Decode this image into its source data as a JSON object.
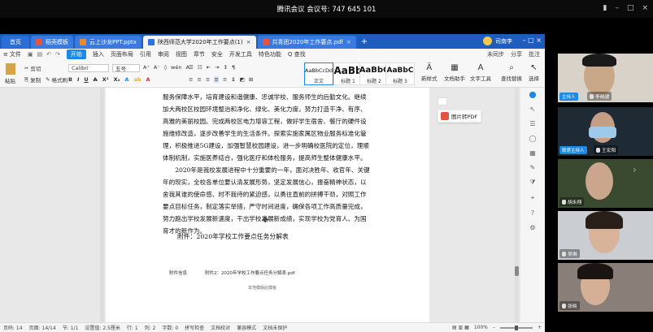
{
  "meeting": {
    "title": "腾讯会议 会议号: 747 645 101",
    "controls": [
      "signal-icon",
      "minimize-icon",
      "maximize-icon",
      "close-icon"
    ]
  },
  "tabs": [
    {
      "label": "首页",
      "type": "home"
    },
    {
      "label": "稻壳模板",
      "icon_color": "#e8513b"
    },
    {
      "label": "云上沙龙PPT.pptx",
      "icon_color": "#e98b2a"
    },
    {
      "label": "陕西师范大学2020年工作要点(1)",
      "icon_color": "#2a74e0",
      "active": true
    },
    {
      "label": "共青团2020年工作要点.pdf",
      "icon_color": "#e8513b"
    }
  ],
  "tab_user": "司南李",
  "menu": {
    "file": "文件",
    "items": [
      "开始",
      "插入",
      "页面布局",
      "引用",
      "审阅",
      "视图",
      "章节",
      "安全",
      "开发工具",
      "特色功能"
    ],
    "active": "开始",
    "search": "Q 查找",
    "right": [
      "未同步",
      "分享",
      "批注"
    ]
  },
  "ribbon": {
    "paste": "粘贴",
    "cut": "剪切",
    "copy": "复制",
    "format_painter": "格式刷",
    "font": "Calibri",
    "size": "五号",
    "styles": [
      {
        "preview": "AaBbCcDd",
        "name": "正文"
      },
      {
        "preview": "AaBb",
        "name": "标题 1"
      },
      {
        "preview": "AaBbC",
        "name": "标题 2"
      },
      {
        "preview": "AaBbC",
        "name": "标题 3"
      }
    ],
    "new_style": "新样式",
    "doc_assist": "文档助手",
    "text_tool": "文字工具",
    "find_replace": "查找替换",
    "select": "选择"
  },
  "document": {
    "paragraph1": "服务保障水平，培育建设和谐健康、忠诚学校、服务师生的后勤文化。继续加大两校区校园环境整治和净化、绿化、美化力度，努力打造干净、有序、高雅的美丽校园。完成两校区电力增容工程，做好学生宿舍、餐厅的硬件设施维修改造，逐步改善学生的生活条件。探索实施家属区物业服务标准化管理，积极推进5G建设，加强智慧校园建设，进一步明确校医院的定位，理顺体制机制，实施医养结合，强化医疗和体检服务，提高师生整体健康水平。",
    "paragraph2": "2020年是我校发展进程中十分重要的一年，面对决胜年、收官年、关键年的现实，全校各单位要认清发展形势，坚定发展信心，振奋精神状态，以舍我其谁的使命感、时不我待的紧迫感，以勇往直前的拼搏干劲，对照工作要点目标任务，制定落实举措，严守时间进度，确保各项工作高质量完成，努力跑出学校发展新速度，干出学校发展新成绩，实现学校为党育人、为国育才的新作为。",
    "attachment": "附件：2020年学校工作要点任务分解表",
    "footnote_label": "附件信息",
    "footnote_file": "附件2：2020年学校工作要点任务分解表.pdf",
    "page_footer": "本地模版此模板"
  },
  "pdf_button": "图片转PDF",
  "status": {
    "words": "页码: 14",
    "page": "页面: 14/14",
    "section": "节: 1/1",
    "setting": "设置值: 2.5厘米",
    "row": "行: 1",
    "col": "列: 2",
    "chars": "字数: 0",
    "spell": "拼写检查",
    "proofread": "文档校对",
    "compat": "兼容模式",
    "protect": "文档未保护",
    "zoom": "100%"
  },
  "videos": [
    {
      "name": "李晓波",
      "role": "主持人",
      "bg": "#d8d2c8",
      "face": "#c9a88a"
    },
    {
      "name": "王宏阳",
      "role": "联席主持人",
      "bg": "#1e2a34",
      "face": "#c59f85"
    },
    {
      "name": "胡永翔",
      "role": "",
      "bg": "#3a4a30",
      "face": "#caa68c"
    },
    {
      "name": "吴琳",
      "role": "",
      "bg": "#caced3",
      "face": "#d8b39a"
    },
    {
      "name": "张晓",
      "role": "",
      "bg": "#8a7f78",
      "face": "#d5b097"
    }
  ]
}
